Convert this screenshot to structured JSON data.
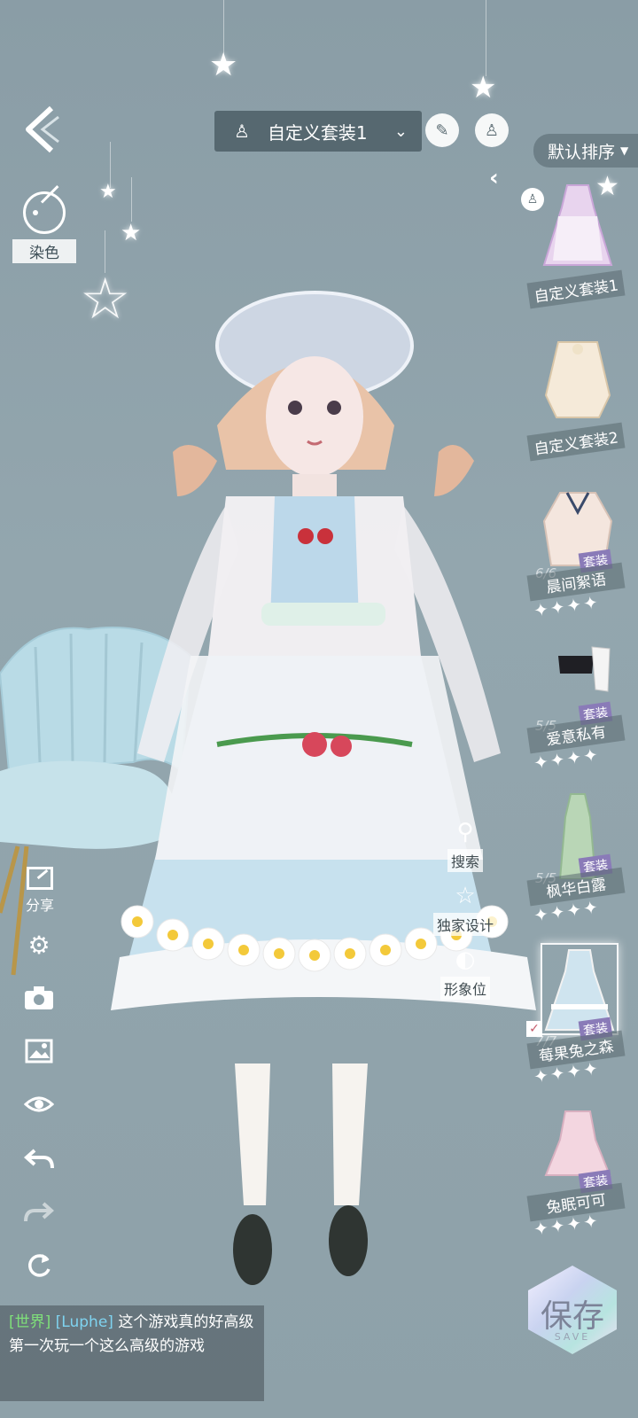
{
  "header": {
    "outfit_name": "自定义套装1",
    "sort_label": "默认排序"
  },
  "dye": {
    "label": "染色"
  },
  "outfits": [
    {
      "name": "自定义套装1",
      "count": "",
      "tag": "",
      "stars": "",
      "custom": true
    },
    {
      "name": "自定义套装2",
      "count": "",
      "tag": "",
      "stars": "",
      "custom": false
    },
    {
      "name": "晨间絮语",
      "count": "6/6",
      "tag": "套装",
      "stars": "✦✦✦✦",
      "custom": false
    },
    {
      "name": "爱意私有",
      "count": "5/5",
      "tag": "套装",
      "stars": "✦✦✦✦",
      "custom": false
    },
    {
      "name": "枫华白露",
      "count": "5/5",
      "tag": "套装",
      "stars": "✦✦✦✦",
      "custom": false
    },
    {
      "name": "莓果兔之森",
      "count": "7/7",
      "tag": "套装",
      "stars": "✦✦✦✦",
      "custom": false,
      "selected": true
    },
    {
      "name": "兔眠可可",
      "count": "",
      "tag": "套装",
      "stars": "✦✦✦✦",
      "custom": false
    }
  ],
  "actions": {
    "search": "搜索",
    "exclusive_design": "独家设计",
    "image_slot": "形象位"
  },
  "tools": {
    "share": "分享"
  },
  "chat": {
    "channel": "[世界]",
    "user": "[Luphe]",
    "message": "这个游戏真的好高级 第一次玩一个这么高级的游戏"
  },
  "save": {
    "label": "保存",
    "sub": "SAVE"
  }
}
